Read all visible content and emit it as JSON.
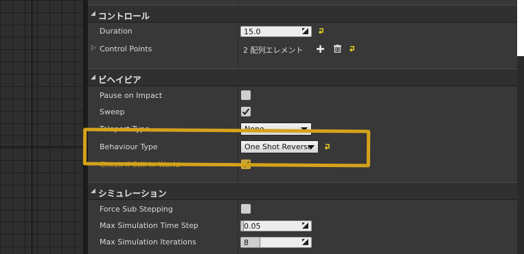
{
  "categories": {
    "control": "コントロール",
    "behavior": "ビヘイビア",
    "simulation": "シミュレーション"
  },
  "control": {
    "duration_label": "Duration",
    "duration_value": "15.0",
    "control_points_label": "Control Points",
    "control_points_value": "2 配列エレメント"
  },
  "behavior": {
    "pause_on_impact_label": "Pause on Impact",
    "pause_on_impact_checked": false,
    "sweep_label": "Sweep",
    "sweep_checked": true,
    "teleport_type_label": "Teleport Type",
    "teleport_type_value": "None",
    "behaviour_type_label": "Behaviour Type",
    "behaviour_type_value": "One Shot Reverse",
    "check_still_label": "Check if Still In World",
    "check_still_checked": true
  },
  "simulation": {
    "force_sub_label": "Force Sub Stepping",
    "force_sub_checked": false,
    "max_time_step_label": "Max Simulation Time Step",
    "max_time_step_value": "0.05",
    "max_iterations_label": "Max Simulation Iterations",
    "max_iterations_value": "8"
  },
  "colors": {
    "highlight": "#d4a21a",
    "reset_arrow": "#e6d21c"
  },
  "icons": [
    "expand-arrow-icon",
    "reset-to-default-icon",
    "add-icon",
    "trash-icon",
    "drag-grip-icon",
    "checkmark-icon",
    "dropdown-caret-icon"
  ]
}
